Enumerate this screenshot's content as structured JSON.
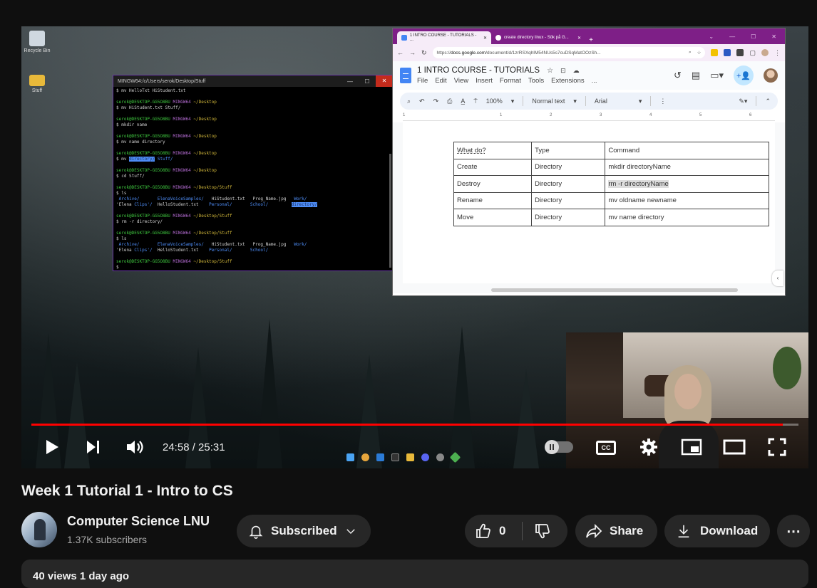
{
  "video": {
    "title": "Week 1 Tutorial 1 - Intro to CS",
    "current_time": "24:58",
    "duration": "25:31",
    "time_display": "24:58 / 25:31",
    "progress_fraction": 0.98,
    "accent_color": "#ff0000"
  },
  "channel": {
    "name": "Computer Science LNU",
    "subscribers": "1.37K subscribers"
  },
  "actions": {
    "subscribed_label": "Subscribed",
    "like_count": "0",
    "share_label": "Share",
    "download_label": "Download",
    "more_label": "⋯"
  },
  "description": {
    "text": "40 views  1 day ago"
  },
  "desktop": {
    "icons": [
      {
        "label": "Recycle Bin",
        "icon": "recycle-bin-icon"
      },
      {
        "label": "Stuff",
        "icon": "folder-icon"
      }
    ]
  },
  "terminal": {
    "title": "MINGW64:/c/Users/serok/Desktop/Stuff",
    "lines": [
      "$ mv HelloTxt HiStudent.txt",
      "",
      "serok@DESKTOP-GG5O8BU MINGW64 ~/Desktop",
      "$ mv HiStudent.txt Stuff/",
      "",
      "serok@DESKTOP-GG5O8BU MINGW64 ~/Desktop",
      "$ mkdir name",
      "",
      "serok@DESKTOP-GG5O8BU MINGW64 ~/Desktop",
      "$ mv name directory",
      "",
      "serok@DESKTOP-GG5O8BU MINGW64 ~/Desktop",
      "$ mv directory/ Stuff/",
      "",
      "serok@DESKTOP-GG5O8BU MINGW64 ~/Desktop",
      "$ cd Stuff/",
      "",
      "serok@DESKTOP-GG5O8BU MINGW64 ~/Desktop/Stuff",
      "$ ls",
      " Archive/       ElenaVoiceSamples/   HiStudent.txt   Prog_Name.jpg   Work/",
      "'Elena Clips'/  HelloStudent.txt    Personal/       School/         directory/",
      "",
      "serok@DESKTOP-GG5O8BU MINGW64 ~/Desktop/Stuff",
      "$ rm -r directory/",
      "",
      "serok@DESKTOP-GG5O8BU MINGW64 ~/Desktop/Stuff",
      "$ ls",
      " Archive/       ElenaVoiceSamples/   HiStudent.txt   Prog_Name.jpg   Work/",
      "'Elena Clips'/  HelloStudent.txt    Personal/       School/",
      "",
      "serok@DESKTOP-GG5O8BU MINGW64 ~/Desktop/Stuff",
      "$"
    ]
  },
  "browser": {
    "tabs": [
      {
        "label": "1 INTRO COURSE - TUTORIALS - ...",
        "active": true
      },
      {
        "label": "create directory linux - Sök på G...",
        "active": false
      }
    ],
    "url_prefix": "https://",
    "url_host": "docs.google.com",
    "url_rest": "/document/d/1zrRSXqhlM54NUs5s7cuDSqMatOOzSh...",
    "doc_title": "1 INTRO COURSE - TUTORIALS",
    "menu": [
      "File",
      "Edit",
      "View",
      "Insert",
      "Format",
      "Tools",
      "Extensions",
      "..."
    ],
    "toolbar": {
      "zoom": "100%",
      "style": "Normal text",
      "font": "Arial"
    },
    "ruler_marks": [
      "1",
      "1",
      "2",
      "3",
      "4",
      "5",
      "6"
    ]
  },
  "doc_table": {
    "headers": [
      "What do?",
      "Type",
      "Command"
    ],
    "rows": [
      [
        "Create",
        "Directory",
        "mkdir directoryName"
      ],
      [
        "Destroy",
        "Directory",
        "rm -r  directoryName"
      ],
      [
        "Rename",
        "Directory",
        "mv oldname newname"
      ],
      [
        "Move",
        "Directory",
        "mv name directory"
      ]
    ]
  }
}
